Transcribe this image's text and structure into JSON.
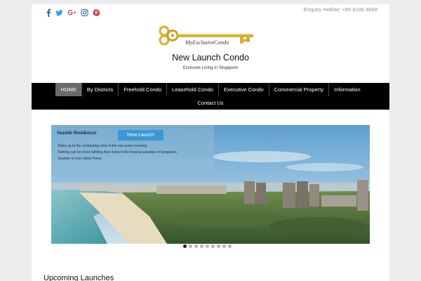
{
  "header": {
    "hotline": "Enquiry Hotline: +65 6100 4668",
    "social": [
      {
        "icon": "facebook-icon",
        "color": "#3b5998"
      },
      {
        "icon": "twitter-icon",
        "color": "#1da1f2"
      },
      {
        "icon": "google-plus-icon",
        "color": "#dd4b39"
      },
      {
        "icon": "instagram-icon",
        "color": "#3f729b"
      },
      {
        "icon": "pinterest-icon",
        "color": "#cb2027"
      }
    ],
    "logo_text": "MyExclusiveCondo",
    "site_title": "New Launch Condo",
    "tagline": "Exclusive Living In Singapore"
  },
  "nav": {
    "row1": [
      "HOME",
      "By Districts",
      "Freehold Condo",
      "Leasehold Condo",
      "Executive Condo",
      "Commercial Property",
      "Information"
    ],
    "row2": [
      "Contact Us"
    ],
    "active": "HOME"
  },
  "slider": {
    "title": "Seaside Residences",
    "button": "New Launch",
    "lines": [
      "Wake up to the enchanting view of the sea every morning.",
      "Nothing can be more fulfilling than living in the tropical paradise of Singapore.",
      "Seaside is now called Home"
    ],
    "slide_count": 9,
    "active_slide": 1
  },
  "sections": {
    "upcoming": "Upcoming Launches"
  },
  "colors": {
    "nav_bg": "#000000",
    "nav_active": "#6a6a6a",
    "accent_button": "#3b97d3",
    "logo_gold": "#d4af37"
  }
}
